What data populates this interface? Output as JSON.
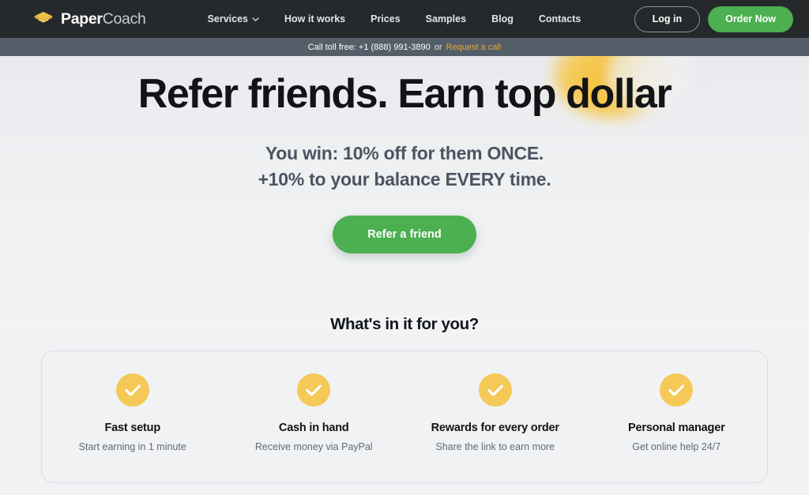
{
  "header": {
    "brand": {
      "name_bold": "Paper",
      "name_light": "Coach",
      "icon": "graduation-cap-icon"
    },
    "nav": [
      {
        "label": "Services",
        "has_dropdown": true,
        "icon": "chevron-down-icon"
      },
      {
        "label": "How it works",
        "has_dropdown": false
      },
      {
        "label": "Prices",
        "has_dropdown": false
      },
      {
        "label": "Samples",
        "has_dropdown": false
      },
      {
        "label": "Blog",
        "has_dropdown": false
      },
      {
        "label": "Contacts",
        "has_dropdown": false
      }
    ],
    "login_label": "Log in",
    "order_label": "Order Now",
    "background_color": "#26292c",
    "accent_green": "#4caf50"
  },
  "phonebar": {
    "text": "Call toll free: +1 (888) 991-3890",
    "separator": "or",
    "link_label": "Request a call",
    "background_color": "#545e68",
    "link_color": "#e8a838"
  },
  "hero": {
    "title": "Refer friends. Earn top dollar",
    "subtitle_line1": "You win: 10% off for them ONCE.",
    "subtitle_line2": "+10% to your balance EVERY time.",
    "cta_label": "Refer a friend",
    "decor_color": "#f3c03c"
  },
  "benefits": {
    "heading": "What's in it for you?",
    "icon_color": "#f5c957",
    "items": [
      {
        "icon": "check-circle-icon",
        "title": "Fast setup",
        "desc": "Start earning in 1 minute"
      },
      {
        "icon": "check-circle-icon",
        "title": "Cash in hand",
        "desc": "Receive money via PayPal"
      },
      {
        "icon": "check-circle-icon",
        "title": "Rewards for every order",
        "desc": "Share the link to earn more"
      },
      {
        "icon": "check-circle-icon",
        "title": "Personal manager",
        "desc": "Get online help 24/7"
      }
    ]
  }
}
